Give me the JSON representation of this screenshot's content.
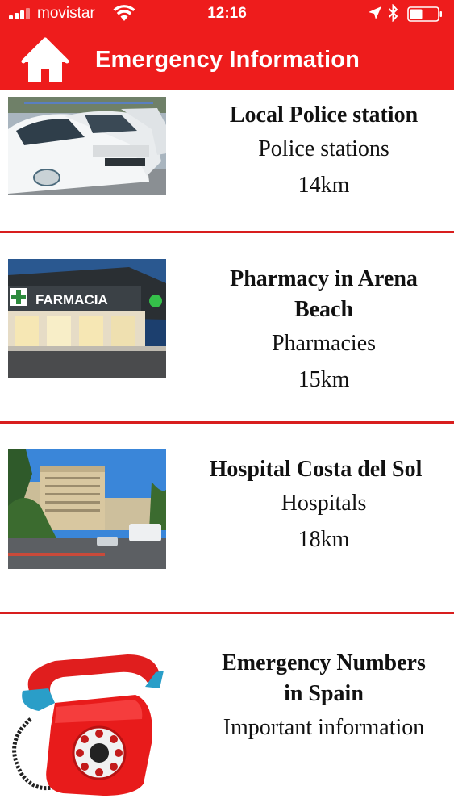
{
  "status_bar": {
    "carrier": "movistar",
    "time": "12:16"
  },
  "nav": {
    "title": "Emergency Information",
    "home_icon": "home-icon"
  },
  "colors": {
    "brand_red": "#ee1c1c",
    "divider_red": "#d81e1e"
  },
  "items": [
    {
      "name": "Local Police station",
      "category": "Police stations",
      "distance": "14km",
      "image": "police-cars-photo"
    },
    {
      "name": "Pharmacy in Arena Beach",
      "category": "Pharmacies",
      "distance": "15km",
      "image": "pharmacy-photo",
      "sign": "FARMACIA"
    },
    {
      "name": "Hospital Costa del Sol",
      "category": "Hospitals",
      "distance": "18km",
      "image": "hospital-photo"
    },
    {
      "name": "Emergency Numbers in Spain",
      "category": "Important information",
      "image": "red-telephone-icon"
    }
  ]
}
